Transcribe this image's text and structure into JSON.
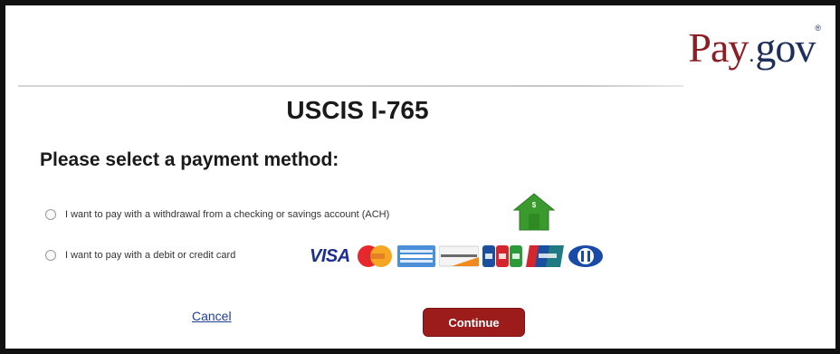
{
  "logo": {
    "pay": "Pay",
    "dot": ".",
    "gov": "gov",
    "reg": "®"
  },
  "page": {
    "title": "USCIS I-765",
    "subtitle": "Please select a payment method:"
  },
  "options": [
    {
      "label": "I want to pay with a withdrawal from a checking or savings account (ACH)",
      "selected": false,
      "icon": "bank-house-icon"
    },
    {
      "label": "I want to pay with a debit or credit card",
      "selected": false,
      "icon": "card-logos"
    }
  ],
  "card_logos": [
    "VISA",
    "MasterCard",
    "AMEX",
    "DISCOVER",
    "JCB",
    "UnionPay",
    "Diners Club"
  ],
  "actions": {
    "cancel": "Cancel",
    "continue": "Continue"
  },
  "colors": {
    "brand_red": "#9c1b1b",
    "brand_navy": "#1e2f5c",
    "link_blue": "#1f3f9a",
    "bank_green": "#3a9a2e"
  }
}
